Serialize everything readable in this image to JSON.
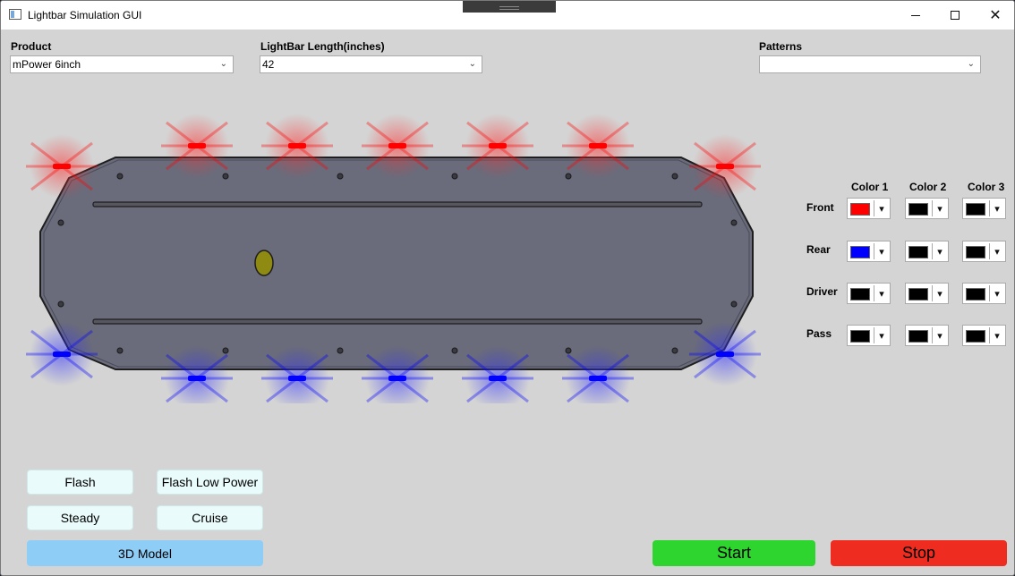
{
  "window": {
    "title": "Lightbar Simulation GUI"
  },
  "fields": {
    "product": {
      "label": "Product",
      "value": "mPower 6inch"
    },
    "length": {
      "label": "LightBar Length(inches)",
      "value": "42"
    },
    "patterns": {
      "label": "Patterns",
      "value": ""
    }
  },
  "colors": {
    "headers": [
      "Color 1",
      "Color 2",
      "Color 3"
    ],
    "rows": [
      {
        "label": "Front",
        "values": [
          "#ff0000",
          "#000000",
          "#000000"
        ]
      },
      {
        "label": "Rear",
        "values": [
          "#0000ff",
          "#000000",
          "#000000"
        ]
      },
      {
        "label": "Driver",
        "values": [
          "#000000",
          "#000000",
          "#000000"
        ]
      },
      {
        "label": "Pass",
        "values": [
          "#000000",
          "#000000",
          "#000000"
        ]
      }
    ]
  },
  "lights": {
    "front_color": "#ff0000",
    "rear_color": "#0000ff",
    "front_count": 8,
    "rear_count": 8
  },
  "modes": {
    "flash": "Flash",
    "flash_low_power": "Flash Low Power",
    "steady": "Steady",
    "cruise": "Cruise",
    "model_3d": "3D Model"
  },
  "actions": {
    "start": "Start",
    "stop": "Stop",
    "start_color": "#2fd52f",
    "stop_color": "#ee2c20"
  }
}
